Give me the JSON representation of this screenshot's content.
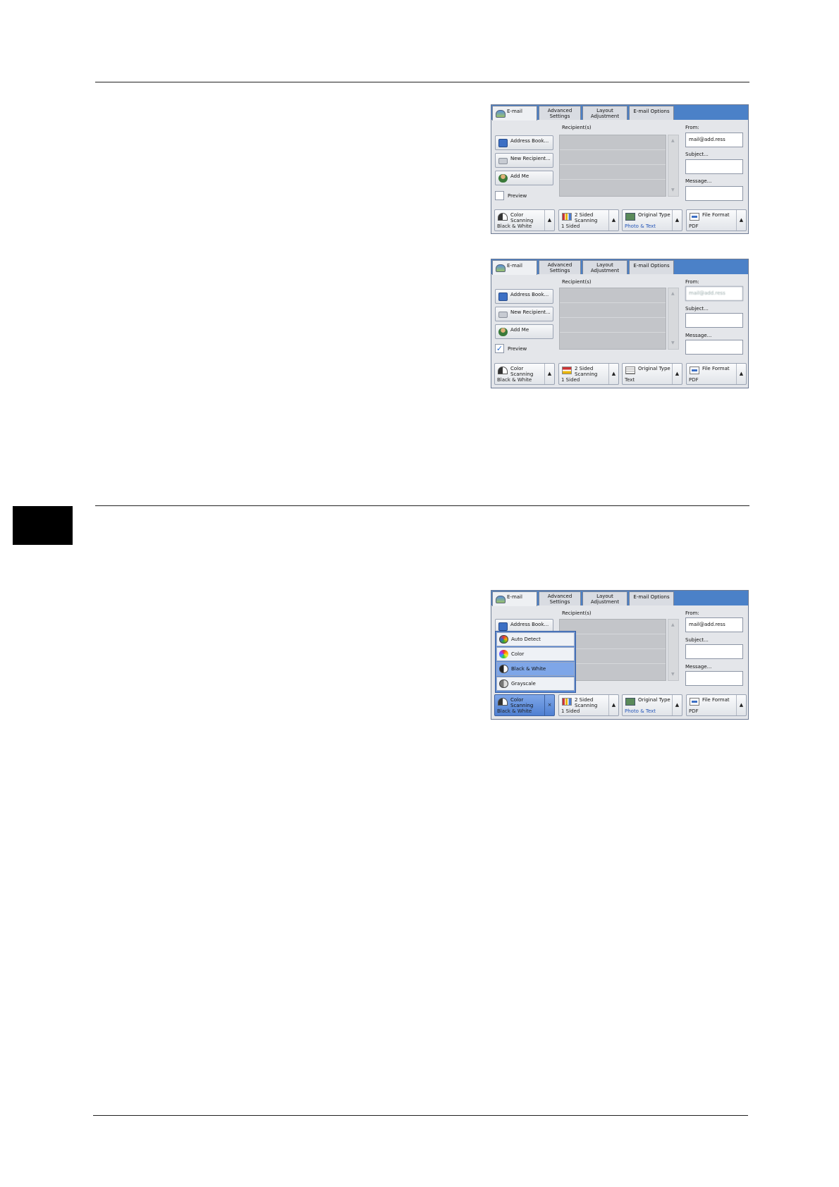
{
  "screens": [
    {
      "tabs": {
        "email": "E-mail",
        "advanced": "Advanced Settings",
        "layout": "Layout Adjustment",
        "options": "E-mail Options"
      },
      "recipients_label": "Recipient(s)",
      "side_buttons": {
        "address_book": "Address Book...",
        "new_recipient": "New Recipient...",
        "add_me": "Add Me"
      },
      "preview": {
        "label": "Preview",
        "checked": false
      },
      "fields": {
        "from_label": "From:",
        "from_value": "mail@add.ress",
        "subject_label": "Subject...",
        "subject_value": "",
        "message_label": "Message...",
        "message_value": ""
      },
      "features": {
        "color": {
          "title": "Color Scanning",
          "value": "Black & White"
        },
        "two_sided": {
          "title": "2 Sided Scanning",
          "value": "1 Sided"
        },
        "original": {
          "title": "Original Type",
          "value": "Photo & Text"
        },
        "format": {
          "title": "File Format",
          "value": "PDF"
        }
      }
    },
    {
      "tabs": {
        "email": "E-mail",
        "advanced": "Advanced Settings",
        "layout": "Layout Adjustment",
        "options": "E-mail Options"
      },
      "recipients_label": "Recipient(s)",
      "side_buttons": {
        "address_book": "Address Book...",
        "new_recipient": "New Recipient...",
        "add_me": "Add Me"
      },
      "preview": {
        "label": "Preview",
        "checked": true
      },
      "fields": {
        "from_label": "From:",
        "from_value": "mail@add.ress",
        "subject_label": "Subject...",
        "subject_value": "",
        "message_label": "Message...",
        "message_value": ""
      },
      "features": {
        "color": {
          "title": "Color Scanning",
          "value": "Black & White"
        },
        "two_sided": {
          "title": "2 Sided Scanning",
          "value": "1 Sided"
        },
        "original": {
          "title": "Original Type",
          "value": "Text"
        },
        "format": {
          "title": "File Format",
          "value": "PDF"
        }
      }
    },
    {
      "tabs": {
        "email": "E-mail",
        "advanced": "Advanced Settings",
        "layout": "Layout Adjustment",
        "options": "E-mail Options"
      },
      "recipients_label": "Recipient(s)",
      "side_buttons": {
        "address_book": "Address Book..."
      },
      "dropdown": [
        "Auto Detect",
        "Color",
        "Black & White",
        "Grayscale"
      ],
      "dropdown_selected": "Black & White",
      "fields": {
        "from_label": "From:",
        "from_value": "mail@add.ress",
        "subject_label": "Subject...",
        "subject_value": "",
        "message_label": "Message...",
        "message_value": ""
      },
      "features": {
        "color": {
          "title": "Color Scanning",
          "value": "Black & White",
          "close": "×"
        },
        "two_sided": {
          "title": "2 Sided Scanning",
          "value": "1 Sided"
        },
        "original": {
          "title": "Original Type",
          "value": "Photo & Text"
        },
        "format": {
          "title": "File Format",
          "value": "PDF"
        }
      }
    }
  ],
  "arrow_up": "▲",
  "arrow_down": "▼"
}
